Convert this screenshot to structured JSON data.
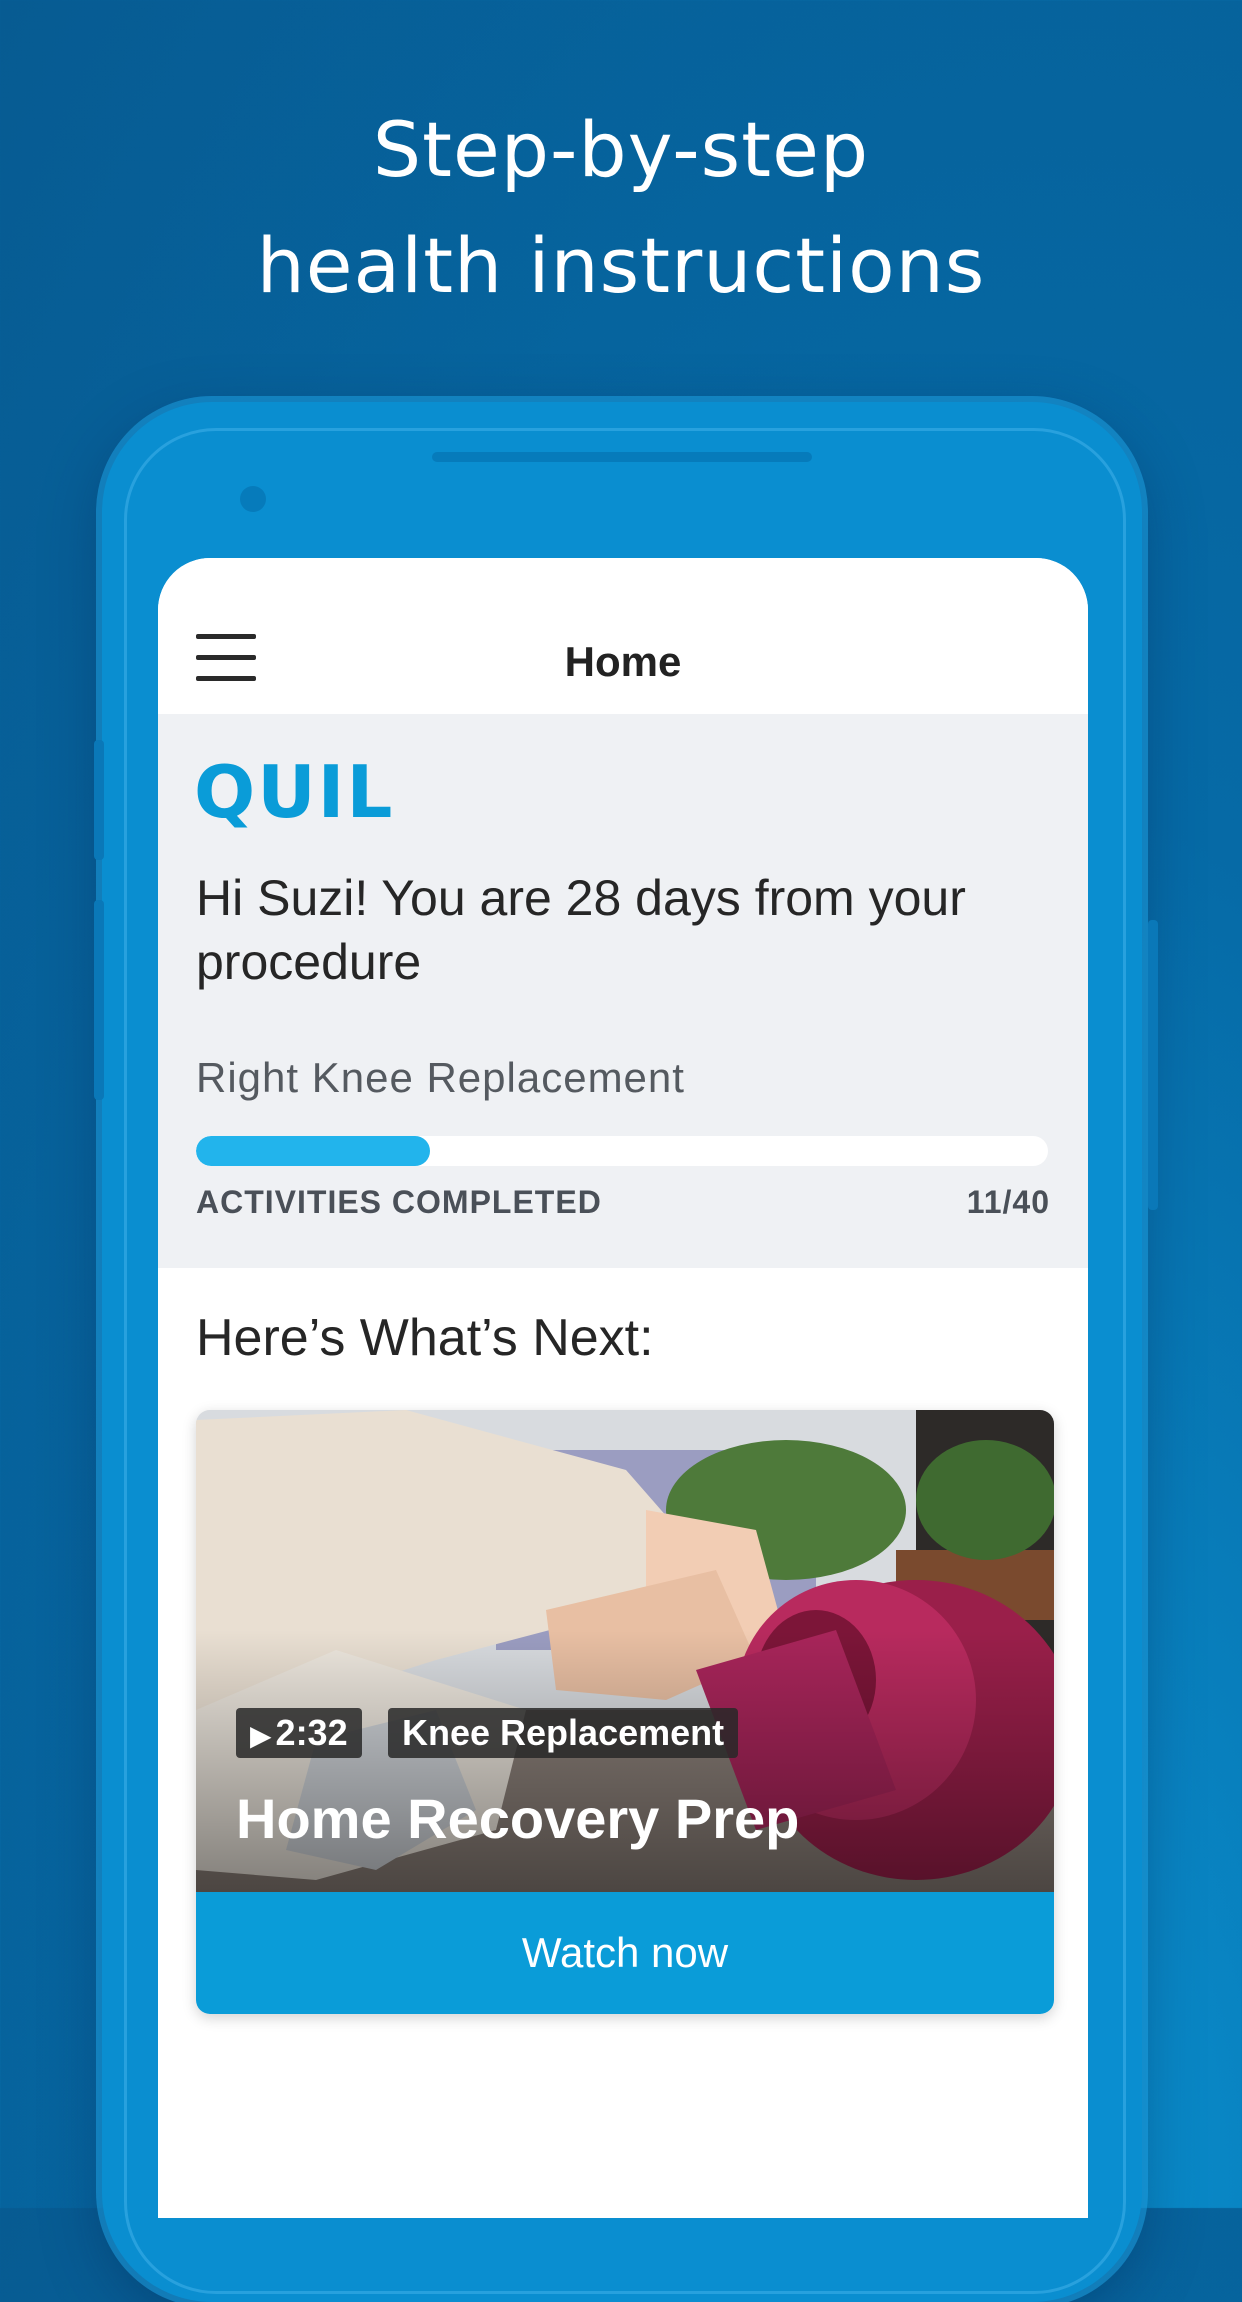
{
  "promo": {
    "line1": "Step-by-step",
    "line2": "health instructions"
  },
  "header": {
    "title": "Home",
    "menu_icon": "hamburger-menu-icon"
  },
  "hero": {
    "logo_text": "QUIL",
    "greeting": "Hi Suzi! You are 28 days from your procedure",
    "procedure_name": "Right Knee Replacement",
    "progress": {
      "label": "ACTIVITIES COMPLETED",
      "completed": 11,
      "total": 40,
      "count_text": "11/40"
    }
  },
  "next": {
    "heading": "Here’s What’s Next:",
    "card": {
      "duration": "2:32",
      "topic": "Knee Replacement",
      "title": "Home Recovery Prep",
      "button_label": "Watch now",
      "play_icon": "play-icon"
    }
  },
  "colors": {
    "brand": "#0a9cd8",
    "progress_fill": "#22b4ec",
    "background": "#066aa6"
  }
}
